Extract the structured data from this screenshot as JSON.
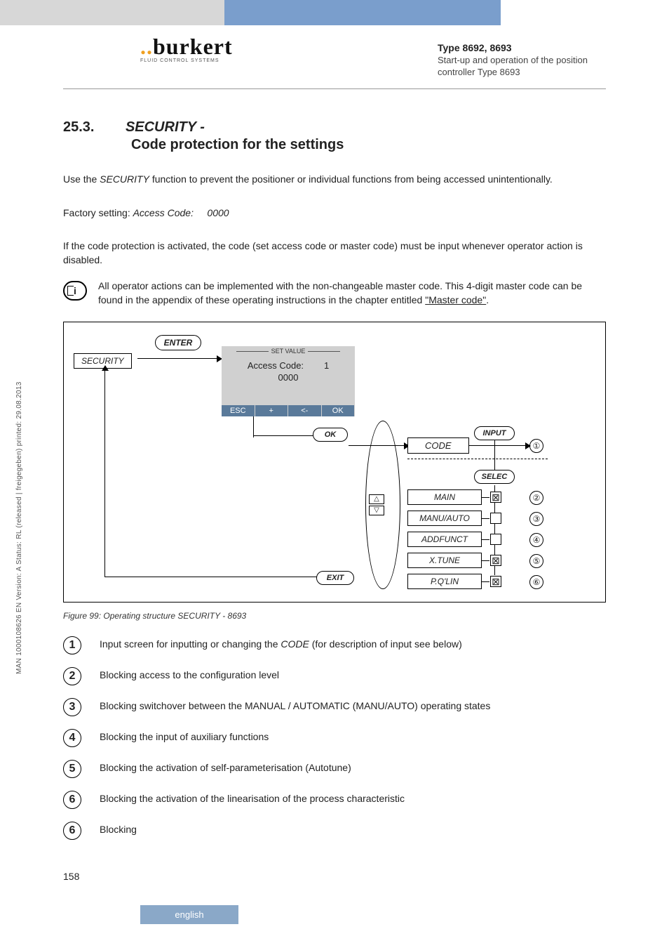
{
  "logo": {
    "brand": "burkert",
    "tagline": "FLUID CONTROL SYSTEMS"
  },
  "header": {
    "type": "Type 8692, 8693",
    "sub": "Start-up and operation of the position controller Type 8693"
  },
  "sideText": "MAN 1000108626 EN Version: A Status: RL (released | freigegeben) printed: 29.08.2013",
  "section": {
    "num": "25.3.",
    "titleItalic": "SECURITY -",
    "titleBold": "Code protection for the settings"
  },
  "p1a": "Use the ",
  "p1b": "SECURITY",
  "p1c": " function to prevent the positioner or individual functions from being accessed unintentionally.",
  "p2a": "Factory setting: ",
  "p2b": "Access Code:",
  "p2c": "0000",
  "p3": "If the code protection is activated, the code (set access code or master code) must be input whenever operator action is disabled.",
  "info1": "All operator actions can be implemented with the non-changeable master code. This 4-digit master code can be found in the appendix of these operating instructions in the chapter entitled ",
  "info2": "\"Master code\"",
  "info3": ".",
  "diagram": {
    "enter": "ENTER",
    "security": "SECURITY",
    "setvalue": "SET VALUE",
    "accesscode": "Access Code:",
    "accessdigit": "1",
    "accessval": "0000",
    "btns": {
      "esc": "ESC",
      "plus": "+",
      "back": "<-",
      "ok": "OK"
    },
    "okbadge": "OK",
    "code": "CODE",
    "input": "INPUT",
    "selec": "SELEC",
    "exit": "EXIT",
    "items": [
      {
        "label": "MAIN",
        "checked": true
      },
      {
        "label": "MANU/AUTO",
        "checked": false
      },
      {
        "label": "ADDFUNCT",
        "checked": false
      },
      {
        "label": "X.TUNE",
        "checked": true
      },
      {
        "label": "P.Q'LIN",
        "checked": true
      }
    ],
    "nums": [
      "①",
      "②",
      "③",
      "④",
      "⑤",
      "⑥"
    ]
  },
  "figcap": "Figure 99:      Operating structure SECURITY - 8693",
  "legend": [
    {
      "n": "1",
      "pre": "Input screen for inputting or changing the ",
      "it": "CODE",
      "post": " (for description of input see below)"
    },
    {
      "n": "2",
      "pre": "Blocking access to the configuration level",
      "it": "",
      "post": ""
    },
    {
      "n": "3",
      "pre": "Blocking switchover between the MANUAL / AUTOMATIC (MANU/AUTO) operating states",
      "it": "",
      "post": ""
    },
    {
      "n": "4",
      "pre": "Blocking the input of auxiliary functions",
      "it": "",
      "post": ""
    },
    {
      "n": "5",
      "pre": "Blocking the activation of self-parameterisation (Autotune)",
      "it": "",
      "post": ""
    },
    {
      "n": "6",
      "pre": "Blocking the activation of the linearisation of the process characteristic",
      "it": "",
      "post": ""
    },
    {
      "n": "6",
      "pre": "Blocking",
      "it": "",
      "post": ""
    }
  ],
  "pageNum": "158",
  "lang": "english"
}
